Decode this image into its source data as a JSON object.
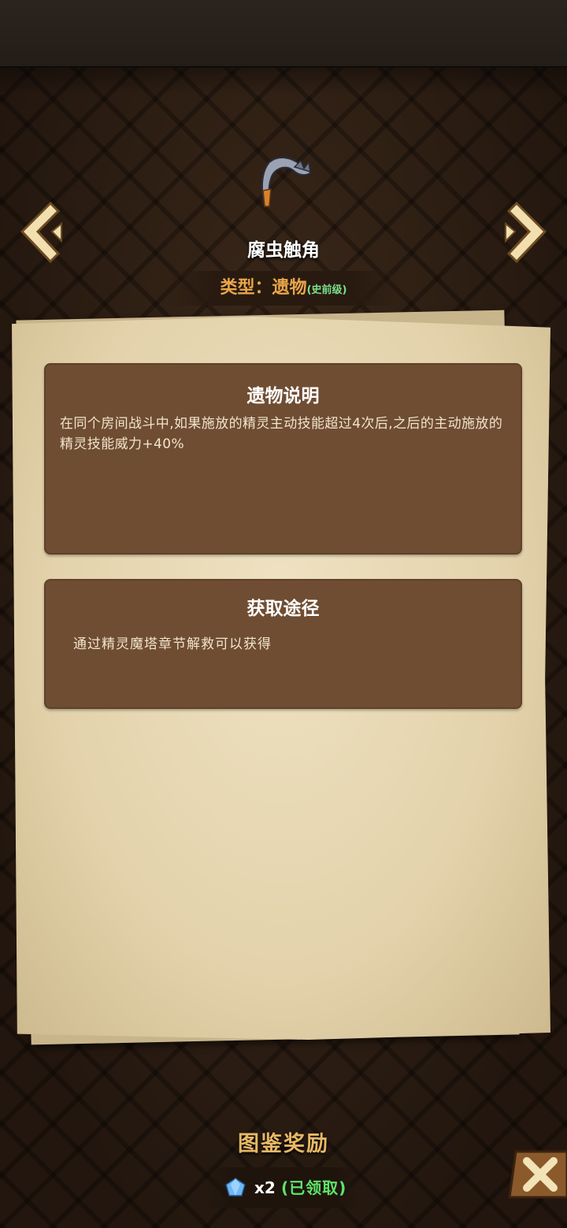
{
  "relic": {
    "name": "腐虫触角",
    "type_label": "类型：",
    "type_value": "遗物",
    "grade": "(史前级)"
  },
  "description": {
    "title": "遗物说明",
    "text": "在同个房间战斗中,如果施放的精灵主动技能超过4次后,之后的主动施放的精灵技能威力+40%"
  },
  "obtain": {
    "title": "获取途径",
    "text": "通过精灵魔塔章节解救可以获得"
  },
  "reward": {
    "title": "图鉴奖励",
    "icon": "diamond-gem-icon",
    "count": "x2",
    "status": "(已领取)"
  },
  "icons": {
    "prev": "chevron-left-icon",
    "next": "chevron-right-icon",
    "close": "close-icon"
  },
  "colors": {
    "accent_gold": "#e8a64a",
    "grade_green": "#7be08a",
    "claimed_green": "#5ee36a",
    "panel_brown": "#6f4d32",
    "paper": "#e8d8b4"
  }
}
